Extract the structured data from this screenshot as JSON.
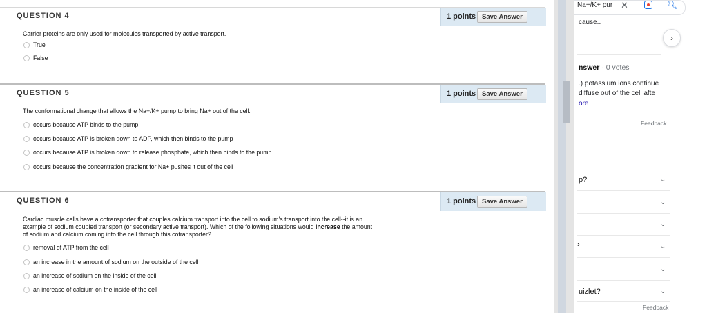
{
  "questions": [
    {
      "title": "QUESTION 4",
      "points": "1 points",
      "save_label": "Save Answer",
      "text": "Carrier proteins are only used for molecules transported by active transport.",
      "options": [
        "True",
        "False"
      ]
    },
    {
      "title": "QUESTION 5",
      "points": "1 points",
      "save_label": "Save Answer",
      "text": "The conformational change that allows the Na+/K+ pump to bring Na+ out of the cell:",
      "options": [
        "occurs because ATP binds to the pump",
        "occurs because ATP is broken down to ADP, which then binds to the pump",
        "occurs because ATP is broken down to release phosphate, which then binds to the pump",
        "occurs because the concentration gradient for Na+ pushes it out of the cell"
      ]
    },
    {
      "title": "QUESTION 6",
      "points": "1 points",
      "save_label": "Save Answer",
      "text_lines": [
        "Cardiac muscle cells have a cotransporter that couples calcium transport into the cell to sodium's transport into the cell--it is an",
        "example of sodium coupled transport (or secondary active transport).  Which of the following situations would",
        "increase",
        " the amount",
        "of sodium and calcium coming into the cell through this cotransporter?"
      ],
      "options": [
        "removal of ATP from the cell",
        "an increase in the amount of sodium on the outside of the cell",
        "an increase of sodium on the inside of the cell",
        "an increase of calcium on the inside of the cell"
      ]
    }
  ],
  "side_panel": {
    "search_text": "Na+/K+ pur",
    "snippet_top": "cause..",
    "answer_label": "nswer",
    "answer_dot": "·",
    "votes": "0 votes",
    "answer_line1": ".) potassium ions continue",
    "answer_line2": "diffuse out of the cell afte",
    "more_link": "ore",
    "feedback1": "Feedback",
    "paa_items": [
      "p?",
      "",
      "",
      "›",
      "",
      "uizlet?"
    ],
    "feedback2": "Feedback"
  },
  "colors": {
    "points_bg": "#dce9f3",
    "link_blue": "#1a0dab",
    "accent_blue": "#1a73e8"
  }
}
